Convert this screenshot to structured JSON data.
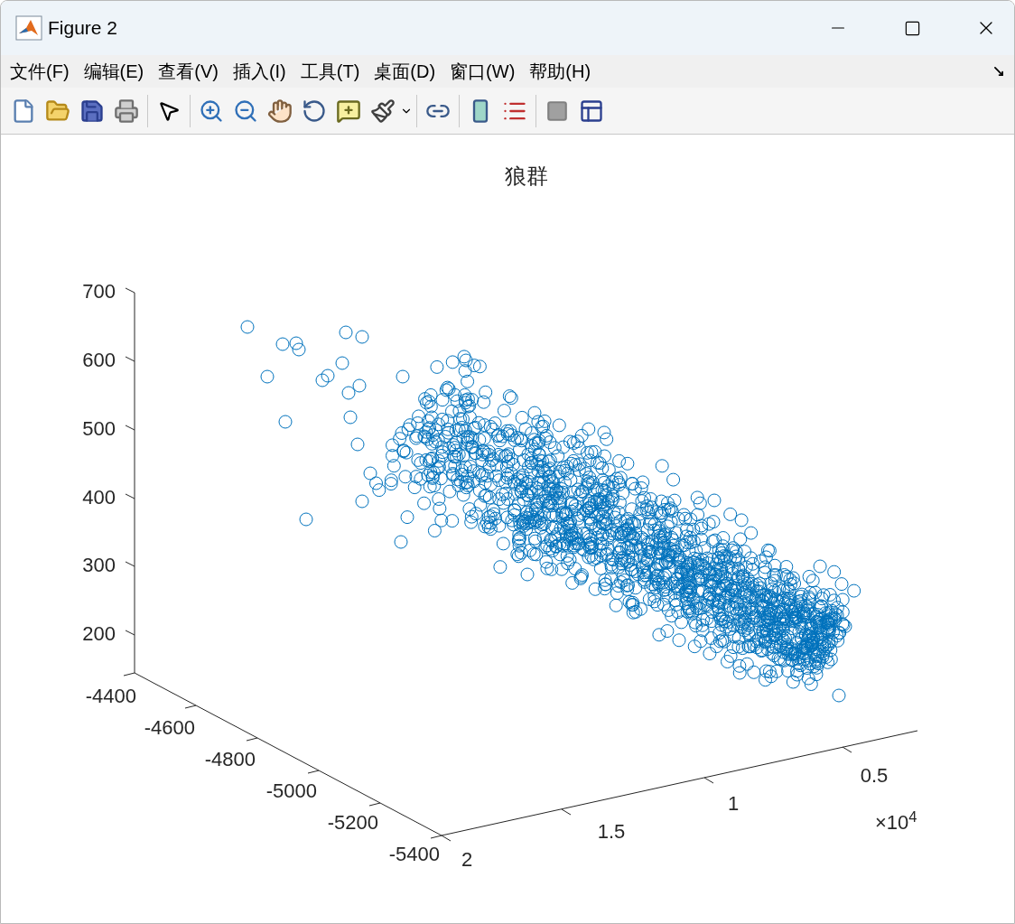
{
  "window": {
    "title": "Figure 2"
  },
  "menu": [
    "文件(F)",
    "编辑(E)",
    "查看(V)",
    "插入(I)",
    "工具(T)",
    "桌面(D)",
    "窗口(W)",
    "帮助(H)"
  ],
  "plot": {
    "title": "狼群",
    "z_ticks": [
      "700",
      "600",
      "500",
      "400",
      "300",
      "200"
    ],
    "y_ticks": [
      "-4400",
      "-4600",
      "-4800",
      "-5000",
      "-5200",
      "-5400"
    ],
    "x_ticks": [
      "2",
      "1.5",
      "1",
      "0.5"
    ],
    "x_exponent": "×10$^{4}$"
  }
}
